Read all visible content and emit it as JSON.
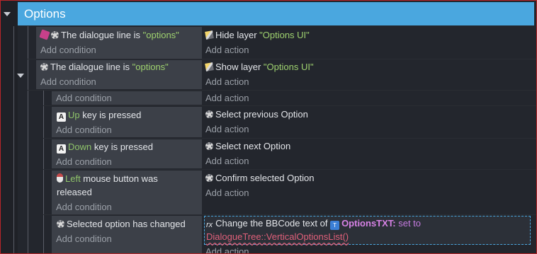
{
  "group": {
    "title": "Options"
  },
  "events": [
    {
      "condition": {
        "pre": "The dialogue line is ",
        "value": "\"options\""
      },
      "action": {
        "pre": "Hide layer ",
        "value": "\"Options UI\""
      }
    },
    {
      "condition": {
        "pre": "The dialogue line is ",
        "value": "\"options\""
      },
      "action": {
        "pre": "Show layer ",
        "value": "\"Options UI\""
      }
    },
    {
      "condition": {
        "key": "Up",
        "post": " key is pressed",
        "key_icon": "A"
      },
      "action": {
        "text": "Select previous Option"
      }
    },
    {
      "condition": {
        "key": "Down",
        "post": " key is pressed",
        "key_icon": "A"
      },
      "action": {
        "text": "Select next Option"
      }
    },
    {
      "condition": {
        "key": "Left",
        "post": " mouse button was",
        "line2": "released"
      },
      "action": {
        "text": "Confirm selected Option"
      }
    },
    {
      "condition": {
        "text": "Selected option has changed"
      },
      "action": {
        "pre": "Change the BBCode text of ",
        "object": "OptionsTXT:",
        "verb": " set to",
        "expression": "DialogueTree::VerticalOptionsList()",
        "var_icon": "rx"
      }
    }
  ],
  "labels": {
    "add_condition": "Add condition",
    "add_action": "Add action"
  },
  "icons": {
    "condition": "gear-icon",
    "layer": "layer-icon",
    "key": "keyboard-key-icon",
    "mouse": "mouse-icon",
    "pin": "pin-icon",
    "variable": "variable-icon",
    "text_object": "text-object-icon"
  },
  "colors": {
    "group_header": "#4aa7df",
    "string": "#9fd26f",
    "object": "#d782e6",
    "error_expression": "#e0607a"
  }
}
